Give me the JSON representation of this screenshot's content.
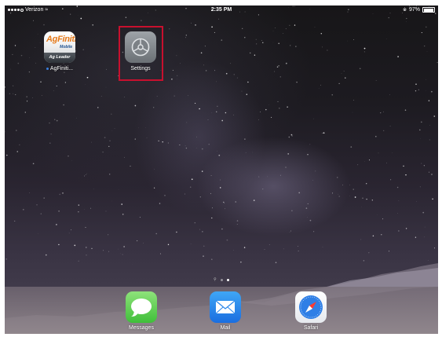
{
  "status_bar": {
    "carrier": "Verizon",
    "time": "2:35 PM",
    "battery_percent": "97%",
    "battery_level": 0.97
  },
  "home": {
    "apps": [
      {
        "label": "AgFiniti...",
        "icon": "agfiniti-app-icon",
        "brand": "AgFiniti",
        "brand_sub": "Mobile",
        "brand_footer": "Ag Leader",
        "badge_dot": true
      },
      {
        "label": "Settings",
        "icon": "gear-icon",
        "highlighted": true,
        "highlight_color": "#c8102e"
      }
    ],
    "page_indicator": {
      "pages": 2,
      "current": 2
    }
  },
  "dock": {
    "apps": [
      {
        "label": "Messages",
        "icon": "message-bubble-icon"
      },
      {
        "label": "Mail",
        "icon": "envelope-icon"
      },
      {
        "label": "Safari",
        "icon": "compass-icon"
      }
    ]
  }
}
